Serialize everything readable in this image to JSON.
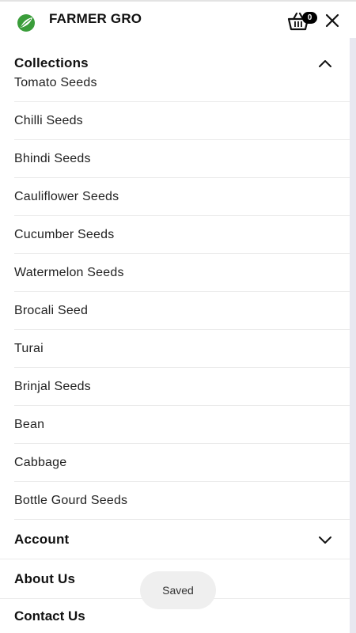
{
  "header": {
    "brand": "FARMER GRO",
    "cart_count": "0",
    "icons": {
      "logo": "leaf-logo",
      "cart": "basket-icon",
      "close": "close-icon"
    }
  },
  "menu": {
    "collections": {
      "label": "Collections",
      "expanded": true,
      "items": [
        "Tomato Seeds",
        "Chilli Seeds",
        "Bhindi Seeds",
        "Cauliflower Seeds",
        "Cucumber Seeds",
        "Watermelon Seeds",
        "Brocali Seed",
        "Turai",
        "Brinjal Seeds",
        "Bean",
        "Cabbage",
        "Bottle Gourd Seeds"
      ]
    },
    "account": {
      "label": "Account",
      "expanded": false
    },
    "about": {
      "label": "About Us"
    },
    "contact": {
      "label": "Contact Us"
    }
  },
  "toast": {
    "text": "Saved"
  },
  "colors": {
    "accent_green": "#3a9d3a",
    "text": "#111111",
    "divider": "#ebebeb",
    "toast_bg": "#efefef"
  }
}
